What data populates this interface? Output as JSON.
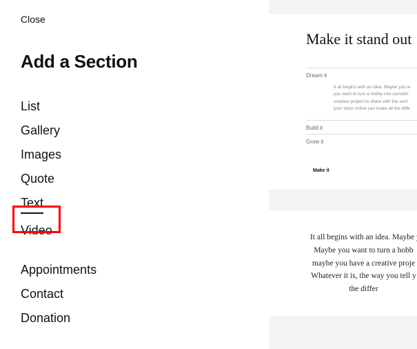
{
  "close_label": "Close",
  "panel_title": "Add a Section",
  "categories_group1": [
    "List",
    "Gallery",
    "Images",
    "Quote",
    "Text",
    "Video"
  ],
  "categories_group2": [
    "Appointments",
    "Contact",
    "Donation"
  ],
  "selected_category": "Text",
  "preview1": {
    "title": "Make it stand out",
    "items": [
      {
        "label": "Dream it",
        "body_lines": [
          "It all begins with an idea. Maybe you w",
          "you want to turn a hobby into somethi",
          "creative project to share with the worl",
          "your story online can make all the diffe"
        ]
      },
      {
        "label": "Build it"
      },
      {
        "label": "Grow it"
      }
    ],
    "button": "Make it"
  },
  "preview2": {
    "body_lines": [
      "It all begins with an idea. Maybe y",
      "Maybe you want to turn a hobb",
      "maybe you have a creative proje",
      "Whatever it is, the way you tell y",
      "the differ"
    ]
  }
}
